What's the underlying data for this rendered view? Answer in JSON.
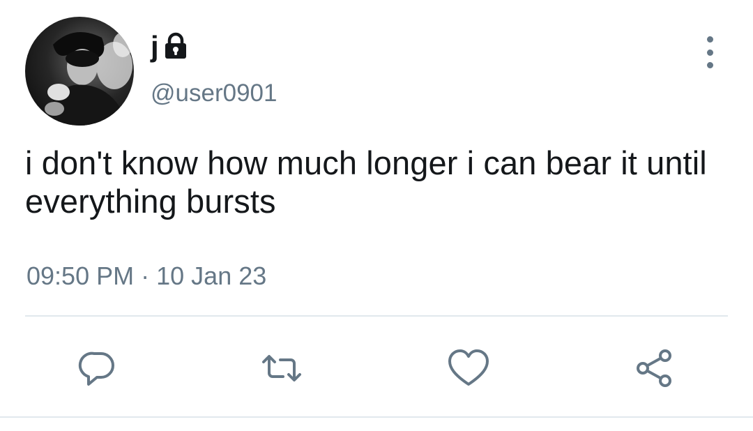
{
  "tweet": {
    "display_name": "j",
    "handle": "@user0901",
    "text": "i don't know how much longer i can bear it until everything bursts",
    "time": "09:50 PM",
    "separator": "·",
    "date": "10 Jan 23",
    "protected": true
  },
  "icons": {
    "lock": "lock-icon",
    "more": "more-vertical-icon",
    "reply": "reply-icon",
    "retweet": "retweet-icon",
    "like": "heart-icon",
    "share": "share-icon"
  },
  "colors": {
    "text_primary": "#14171a",
    "text_secondary": "#657786",
    "icon": "#657786",
    "divider": "#e1e8ed",
    "background": "#ffffff"
  }
}
